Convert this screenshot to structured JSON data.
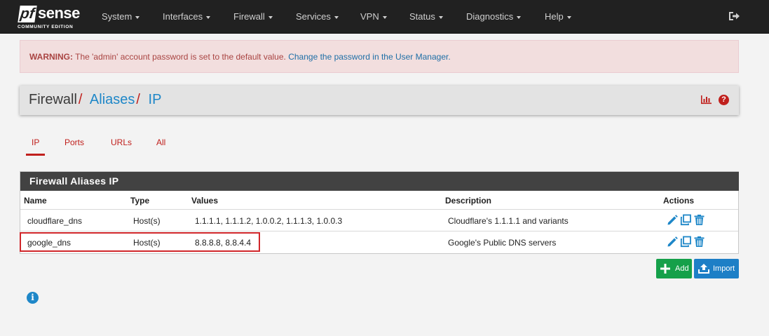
{
  "navbar": {
    "logo": {
      "pf": "pf",
      "sense": "sense",
      "edition": "COMMUNITY EDITION"
    },
    "items": [
      "System",
      "Interfaces",
      "Firewall",
      "Services",
      "VPN",
      "Status",
      "Diagnostics",
      "Help"
    ],
    "logout_icon": "logout-icon"
  },
  "alert": {
    "label": "WARNING:",
    "message": " The 'admin' account password is set to the default value. ",
    "link": "Change the password in the User Manager."
  },
  "breadcrumb": {
    "items": [
      "Firewall",
      "Aliases",
      "IP"
    ],
    "separator": "/"
  },
  "tabs": [
    "IP",
    "Ports",
    "URLs",
    "All"
  ],
  "active_tab": "IP",
  "table": {
    "title": "Firewall Aliases IP",
    "columns": [
      "Name",
      "Type",
      "Values",
      "Description",
      "Actions"
    ],
    "rows": [
      {
        "name": "cloudflare_dns",
        "type": "Host(s)",
        "values": "1.1.1.1, 1.1.1.2, 1.0.0.2, 1.1.1.3, 1.0.0.3",
        "description": "Cloudflare's 1.1.1.1 and variants"
      },
      {
        "name": "google_dns",
        "type": "Host(s)",
        "values": "8.8.8.8, 8.8.4.4",
        "description": "Google's Public DNS servers"
      }
    ]
  },
  "buttons": {
    "add": "Add",
    "import": "Import"
  },
  "colors": {
    "brand_red": "#c0201d",
    "link_blue": "#1e87c8",
    "add_green": "#15a04a",
    "import_blue": "#1d7fc6",
    "navbar": "#212121"
  }
}
